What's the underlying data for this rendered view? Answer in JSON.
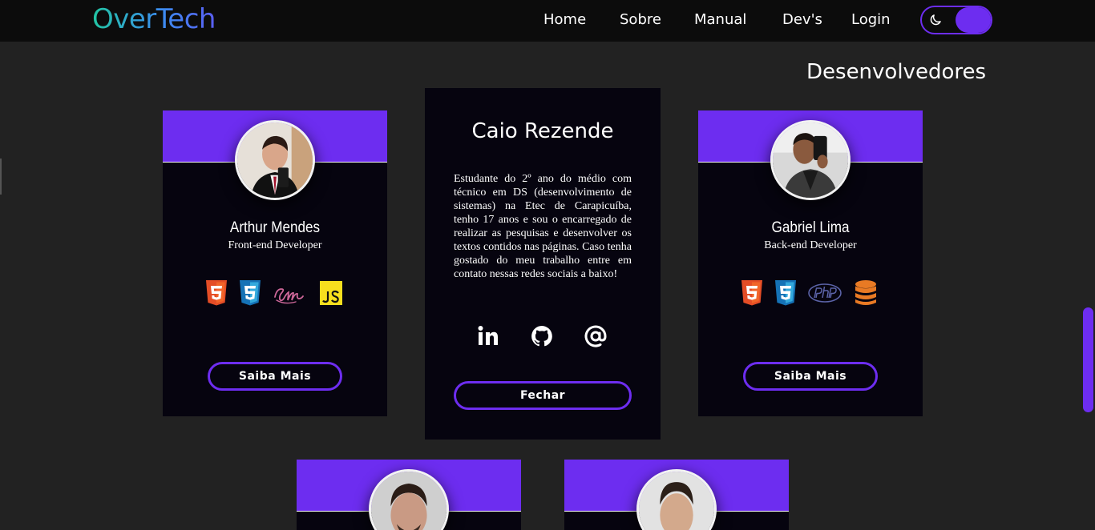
{
  "navbar": {
    "logo": "OverTech",
    "links": [
      "Home",
      "Sobre",
      "Manual",
      "Dev's",
      "Login"
    ],
    "theme_toggle": {
      "icon": "moon-icon",
      "state": "dark"
    }
  },
  "page": {
    "title": "Desenvolvedores"
  },
  "cards": [
    {
      "name": "Arthur Mendes",
      "role": "Front-end Developer",
      "tech_icons": [
        "html5-icon",
        "css3-icon",
        "sass-icon",
        "javascript-icon"
      ],
      "button_label": "Saiba Mais"
    },
    {
      "name": "Gabriel Lima",
      "role": "Back-end Developer",
      "tech_icons": [
        "html5-icon",
        "css3-icon",
        "php-icon",
        "database-icon"
      ],
      "button_label": "Saiba Mais"
    }
  ],
  "expanded_card": {
    "name": "Caio Rezende",
    "bio": "Estudante do 2º ano do médio com técnico em DS (desenvolvimento de sistemas) na Etec de Carapicuíba, tenho 17 anos e sou o encarregado de realizar as pesquisas e desenvolver os textos contidos nas páginas. Caso tenha gostado do meu trabalho entre em contato nessas redes sociais a baixo!",
    "social_icons": [
      "linkedin-icon",
      "github-icon",
      "email-at-icon"
    ],
    "close_label": "Fechar"
  },
  "colors": {
    "accent": "#6d2df0",
    "background": "#222222",
    "navbar": "#0c0c0c",
    "card": "#06040f"
  }
}
